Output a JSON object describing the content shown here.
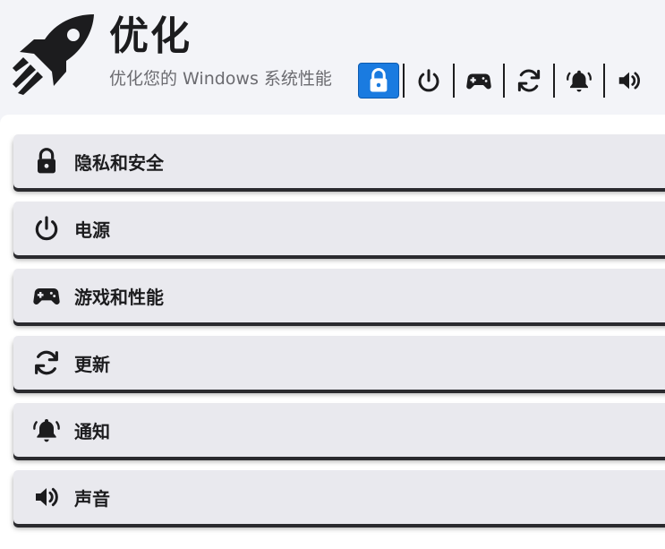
{
  "header": {
    "title": "优化",
    "subtitle": "优化您的 Windows 系统性能",
    "logo_icon": "rocket-icon"
  },
  "toolbar": {
    "buttons": [
      {
        "icon": "lock-icon",
        "active": true
      },
      {
        "icon": "power-icon",
        "active": false
      },
      {
        "icon": "gamepad-icon",
        "active": false
      },
      {
        "icon": "refresh-icon",
        "active": false
      },
      {
        "icon": "bell-icon",
        "active": false
      },
      {
        "icon": "volume-icon",
        "active": false
      }
    ],
    "active_color": "#1a7be0"
  },
  "sections": [
    {
      "icon": "lock-icon",
      "label": "隐私和安全"
    },
    {
      "icon": "power-icon",
      "label": "电源"
    },
    {
      "icon": "gamepad-icon",
      "label": "游戏和性能"
    },
    {
      "icon": "refresh-icon",
      "label": "更新"
    },
    {
      "icon": "bell-icon",
      "label": "通知"
    },
    {
      "icon": "volume-icon",
      "label": "声音"
    }
  ]
}
